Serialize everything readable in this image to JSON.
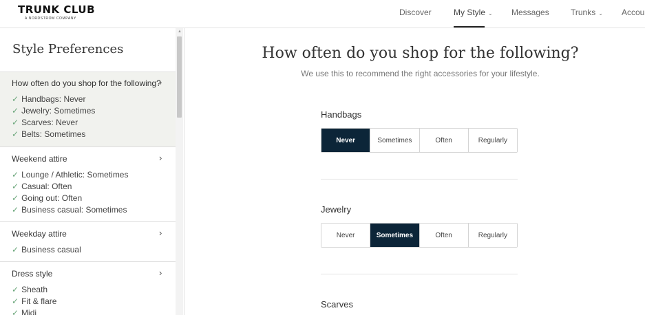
{
  "header": {
    "logo_main": "TRUNK CLUB",
    "logo_sub": "A NORDSTROM COMPANY",
    "nav": {
      "discover": "Discover",
      "my_style": "My Style",
      "messages": "Messages",
      "trunks": "Trunks",
      "account": "Accou"
    },
    "active_nav": "My Style"
  },
  "sidebar": {
    "title": "Style Preferences",
    "sections": [
      {
        "title": "How often do you shop for the following?",
        "items": [
          "Handbags: Never",
          "Jewelry: Sometimes",
          "Scarves: Never",
          "Belts: Sometimes"
        ]
      },
      {
        "title": "Weekend attire",
        "items": [
          "Lounge / Athletic: Sometimes",
          "Casual: Often",
          "Going out: Often",
          "Business casual: Sometimes"
        ]
      },
      {
        "title": "Weekday attire",
        "items": [
          "Business casual"
        ]
      },
      {
        "title": "Dress style",
        "items": [
          "Sheath",
          "Fit & flare",
          "Midi"
        ]
      }
    ],
    "check_glyph": "✓",
    "chevron_glyph": "›"
  },
  "main": {
    "title": "How often do you shop for the following?",
    "subtitle": "We use this to recommend the right accessories for your lifestyle.",
    "questions": [
      {
        "label": "Handbags",
        "options": [
          "Never",
          "Sometimes",
          "Often",
          "Regularly"
        ],
        "selected": "Never"
      },
      {
        "label": "Jewelry",
        "options": [
          "Never",
          "Sometimes",
          "Often",
          "Regularly"
        ],
        "selected": "Sometimes"
      },
      {
        "label": "Scarves"
      }
    ]
  },
  "colors": {
    "selected_bg": "#0c2538",
    "check": "#6aa67a",
    "active_section_bg": "#f1f2ee"
  }
}
